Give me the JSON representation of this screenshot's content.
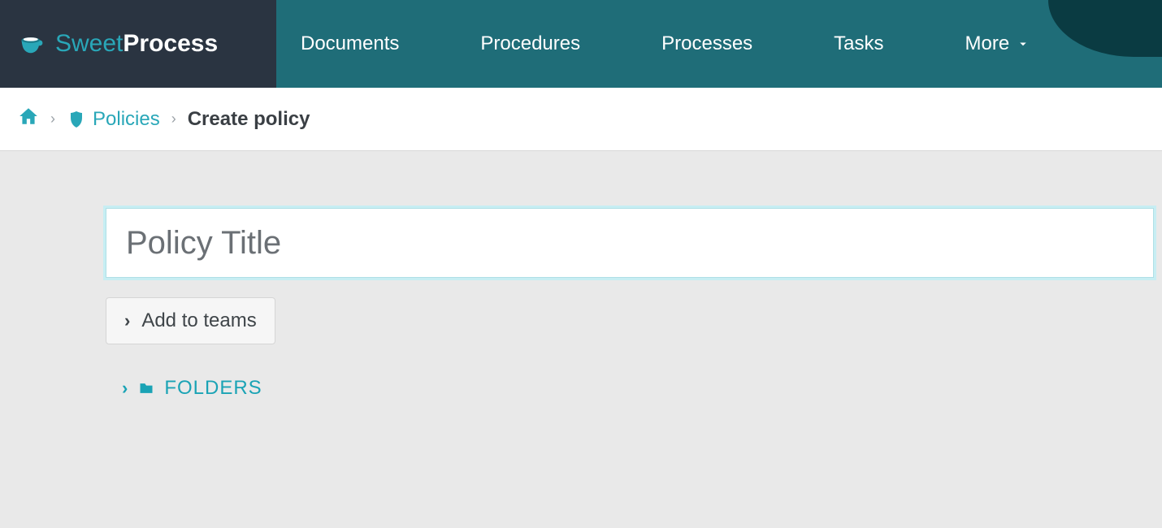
{
  "brand": {
    "name_light": "Sweet",
    "name_bold": "Process"
  },
  "nav": {
    "documents": "Documents",
    "procedures": "Procedures",
    "processes": "Processes",
    "tasks": "Tasks",
    "more": "More"
  },
  "breadcrumb": {
    "policies": "Policies",
    "current": "Create policy"
  },
  "form": {
    "title_placeholder": "Policy Title",
    "add_to_teams": "Add to teams",
    "folders": "FOLDERS"
  },
  "colors": {
    "accent": "#29a7b8",
    "nav_bg": "#1f6d78",
    "brand_bg": "#2a3441"
  }
}
